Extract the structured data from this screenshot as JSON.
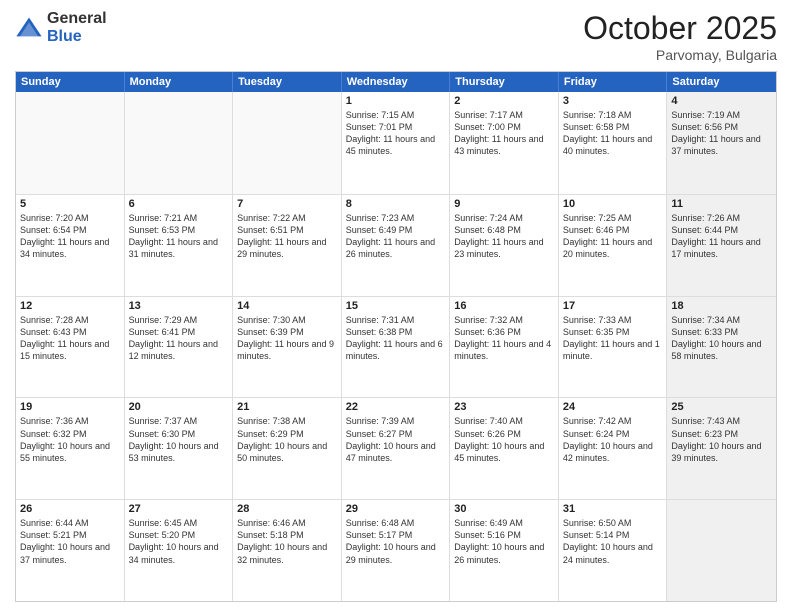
{
  "header": {
    "logo_general": "General",
    "logo_blue": "Blue",
    "month_title": "October 2025",
    "location": "Parvomay, Bulgaria"
  },
  "calendar": {
    "weekdays": [
      "Sunday",
      "Monday",
      "Tuesday",
      "Wednesday",
      "Thursday",
      "Friday",
      "Saturday"
    ],
    "rows": [
      [
        {
          "day": "",
          "text": "",
          "empty": true
        },
        {
          "day": "",
          "text": "",
          "empty": true
        },
        {
          "day": "",
          "text": "",
          "empty": true
        },
        {
          "day": "1",
          "text": "Sunrise: 7:15 AM\nSunset: 7:01 PM\nDaylight: 11 hours and 45 minutes."
        },
        {
          "day": "2",
          "text": "Sunrise: 7:17 AM\nSunset: 7:00 PM\nDaylight: 11 hours and 43 minutes."
        },
        {
          "day": "3",
          "text": "Sunrise: 7:18 AM\nSunset: 6:58 PM\nDaylight: 11 hours and 40 minutes."
        },
        {
          "day": "4",
          "text": "Sunrise: 7:19 AM\nSunset: 6:56 PM\nDaylight: 11 hours and 37 minutes.",
          "shaded": true
        }
      ],
      [
        {
          "day": "5",
          "text": "Sunrise: 7:20 AM\nSunset: 6:54 PM\nDaylight: 11 hours and 34 minutes."
        },
        {
          "day": "6",
          "text": "Sunrise: 7:21 AM\nSunset: 6:53 PM\nDaylight: 11 hours and 31 minutes."
        },
        {
          "day": "7",
          "text": "Sunrise: 7:22 AM\nSunset: 6:51 PM\nDaylight: 11 hours and 29 minutes."
        },
        {
          "day": "8",
          "text": "Sunrise: 7:23 AM\nSunset: 6:49 PM\nDaylight: 11 hours and 26 minutes."
        },
        {
          "day": "9",
          "text": "Sunrise: 7:24 AM\nSunset: 6:48 PM\nDaylight: 11 hours and 23 minutes."
        },
        {
          "day": "10",
          "text": "Sunrise: 7:25 AM\nSunset: 6:46 PM\nDaylight: 11 hours and 20 minutes."
        },
        {
          "day": "11",
          "text": "Sunrise: 7:26 AM\nSunset: 6:44 PM\nDaylight: 11 hours and 17 minutes.",
          "shaded": true
        }
      ],
      [
        {
          "day": "12",
          "text": "Sunrise: 7:28 AM\nSunset: 6:43 PM\nDaylight: 11 hours and 15 minutes."
        },
        {
          "day": "13",
          "text": "Sunrise: 7:29 AM\nSunset: 6:41 PM\nDaylight: 11 hours and 12 minutes."
        },
        {
          "day": "14",
          "text": "Sunrise: 7:30 AM\nSunset: 6:39 PM\nDaylight: 11 hours and 9 minutes."
        },
        {
          "day": "15",
          "text": "Sunrise: 7:31 AM\nSunset: 6:38 PM\nDaylight: 11 hours and 6 minutes."
        },
        {
          "day": "16",
          "text": "Sunrise: 7:32 AM\nSunset: 6:36 PM\nDaylight: 11 hours and 4 minutes."
        },
        {
          "day": "17",
          "text": "Sunrise: 7:33 AM\nSunset: 6:35 PM\nDaylight: 11 hours and 1 minute."
        },
        {
          "day": "18",
          "text": "Sunrise: 7:34 AM\nSunset: 6:33 PM\nDaylight: 10 hours and 58 minutes.",
          "shaded": true
        }
      ],
      [
        {
          "day": "19",
          "text": "Sunrise: 7:36 AM\nSunset: 6:32 PM\nDaylight: 10 hours and 55 minutes."
        },
        {
          "day": "20",
          "text": "Sunrise: 7:37 AM\nSunset: 6:30 PM\nDaylight: 10 hours and 53 minutes."
        },
        {
          "day": "21",
          "text": "Sunrise: 7:38 AM\nSunset: 6:29 PM\nDaylight: 10 hours and 50 minutes."
        },
        {
          "day": "22",
          "text": "Sunrise: 7:39 AM\nSunset: 6:27 PM\nDaylight: 10 hours and 47 minutes."
        },
        {
          "day": "23",
          "text": "Sunrise: 7:40 AM\nSunset: 6:26 PM\nDaylight: 10 hours and 45 minutes."
        },
        {
          "day": "24",
          "text": "Sunrise: 7:42 AM\nSunset: 6:24 PM\nDaylight: 10 hours and 42 minutes."
        },
        {
          "day": "25",
          "text": "Sunrise: 7:43 AM\nSunset: 6:23 PM\nDaylight: 10 hours and 39 minutes.",
          "shaded": true
        }
      ],
      [
        {
          "day": "26",
          "text": "Sunrise: 6:44 AM\nSunset: 5:21 PM\nDaylight: 10 hours and 37 minutes."
        },
        {
          "day": "27",
          "text": "Sunrise: 6:45 AM\nSunset: 5:20 PM\nDaylight: 10 hours and 34 minutes."
        },
        {
          "day": "28",
          "text": "Sunrise: 6:46 AM\nSunset: 5:18 PM\nDaylight: 10 hours and 32 minutes."
        },
        {
          "day": "29",
          "text": "Sunrise: 6:48 AM\nSunset: 5:17 PM\nDaylight: 10 hours and 29 minutes."
        },
        {
          "day": "30",
          "text": "Sunrise: 6:49 AM\nSunset: 5:16 PM\nDaylight: 10 hours and 26 minutes."
        },
        {
          "day": "31",
          "text": "Sunrise: 6:50 AM\nSunset: 5:14 PM\nDaylight: 10 hours and 24 minutes."
        },
        {
          "day": "",
          "text": "",
          "empty": true,
          "shaded": true
        }
      ]
    ]
  }
}
